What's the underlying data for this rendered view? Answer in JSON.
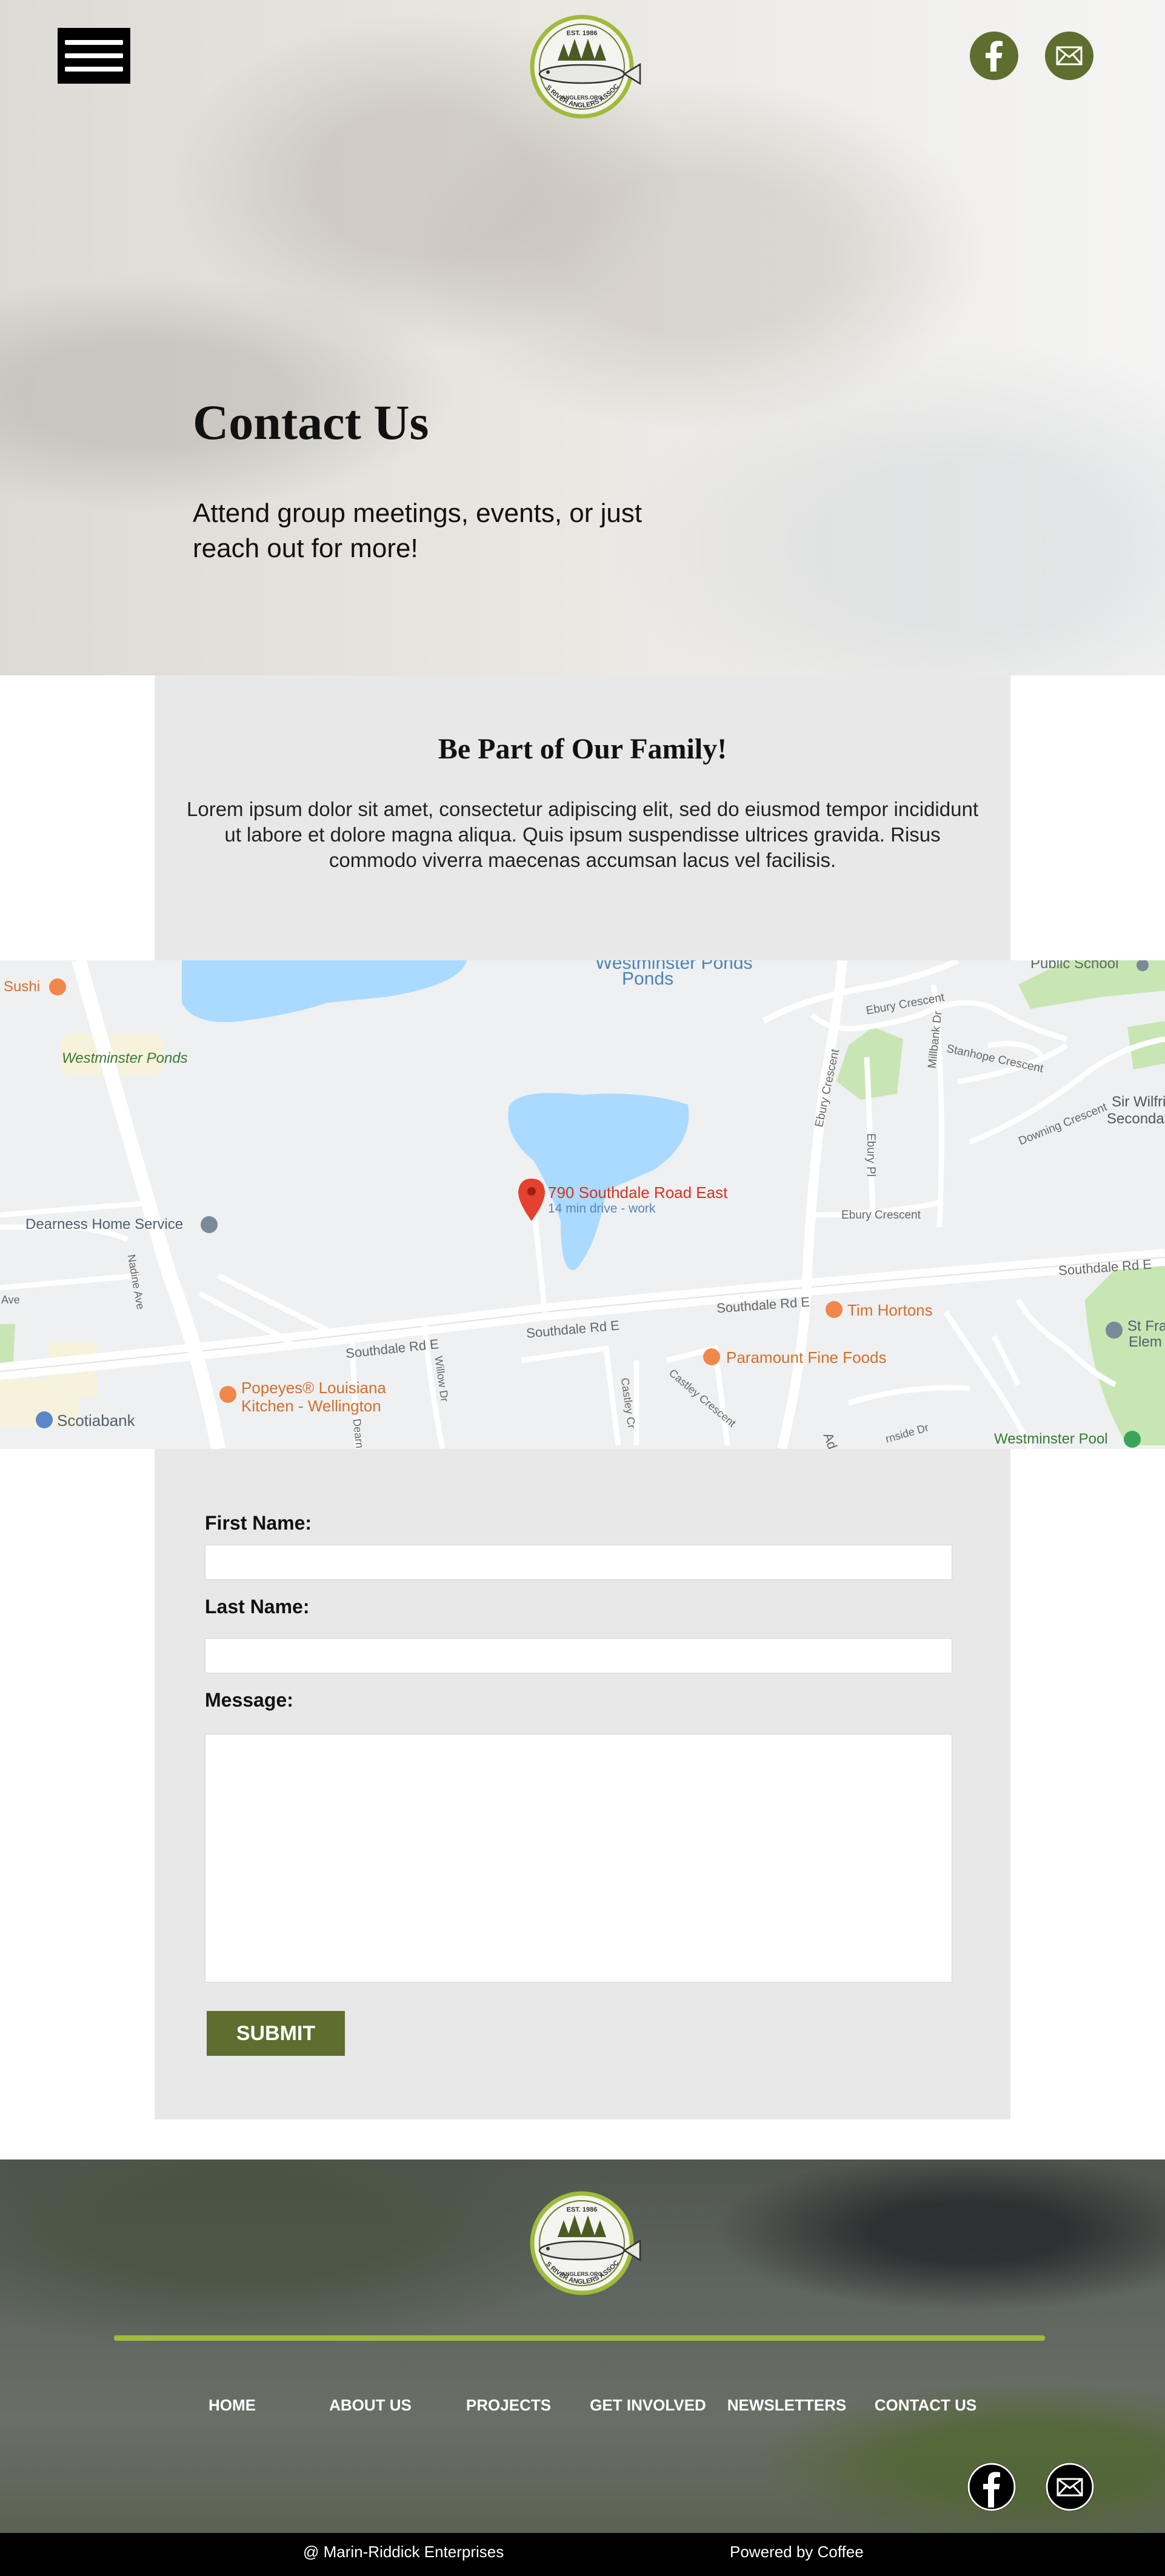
{
  "header": {
    "menu_label": "",
    "logo": {
      "top_text": "EST. 1986",
      "ring_text": "THAMES RIVER ANGLERS ASSOCIATION",
      "url_text": "ANGLERS.ORG"
    },
    "social": [
      "facebook-icon",
      "mail-icon"
    ],
    "accent_color": "#5f6d2e"
  },
  "hero": {
    "title": "Contact Us",
    "subtitle": "Attend group meetings, events, or just reach out for more!"
  },
  "intro": {
    "heading": "Be Part of Our Family!",
    "body": "Lorem ipsum dolor sit amet, consectetur adipiscing elit, sed do eiusmod tempor incididunt ut labore et dolore magna aliqua. Quis ipsum suspendisse ultrices gravida. Risus commodo viverra maecenas accumsan lacus vel facilisis."
  },
  "map": {
    "pin_title": "790 Southdale Road East",
    "pin_subtitle": "14 min drive - work",
    "labels": {
      "westminster_ponds_top": "Westminster Ponds",
      "public_school": "Public School",
      "sushi": "Sushi",
      "westminster_ponds_green": "Westminster Ponds",
      "ebury_crescent_1": "Ebury Crescent",
      "ebury_crescent_2": "Ebury Crescent",
      "ebury_crescent_3": "Ebury Crescent",
      "ebury_pl": "Ebury Pl",
      "millbank_dr": "Millbank Dr",
      "stanhope_crescent": "Stanhope Crescent",
      "downing_crescent": "Downing Crescent",
      "sir_wilfrid": "Sir Wilfri",
      "secondary": "Seconda",
      "dearness": "Dearness Home Service",
      "nadine_ave": "Nadine Ave",
      "ave": "Ave",
      "southdale_rd_e_1": "Southdale Rd E",
      "southdale_rd_e_2": "Southdale Rd E",
      "southdale_rd_e_3": "Southdale Rd E",
      "southdale_rd_e_4": "Southdale Rd E",
      "tim_hortons": "Tim Hortons",
      "paramount": "Paramount Fine Foods",
      "st_fra": "St Fra",
      "elem": "Elem",
      "popeyes_1": "Popeyes® Louisiana",
      "popeyes_2": "Kitchen - Wellington",
      "willow_dr": "Willow Dr",
      "scotiabank": "Scotiabank",
      "castley_cr": "Castley Cr",
      "castley_crescent": "Castley Crescent",
      "westminster_pool": "Westminster Pool",
      "dearn": "Dearn",
      "ad": "Ad",
      "dale_dr": "rnside Dr"
    }
  },
  "form": {
    "first_name_label": "First Name:",
    "last_name_label": "Last Name:",
    "message_label": "Message:",
    "first_name_value": "",
    "last_name_value": "",
    "message_value": "",
    "submit_label": "SUBMIT"
  },
  "footer": {
    "nav": [
      "HOME",
      "ABOUT US",
      "PROJECTS",
      "GET INVOLVED",
      "NEWSLETTERS",
      "CONTACT US"
    ],
    "social": [
      "facebook-icon",
      "mail-icon"
    ],
    "copyright": "@ Marin-Riddick Enterprises",
    "powered_by": "Powered by Coffee",
    "rule_color": "#9fbb3a"
  }
}
